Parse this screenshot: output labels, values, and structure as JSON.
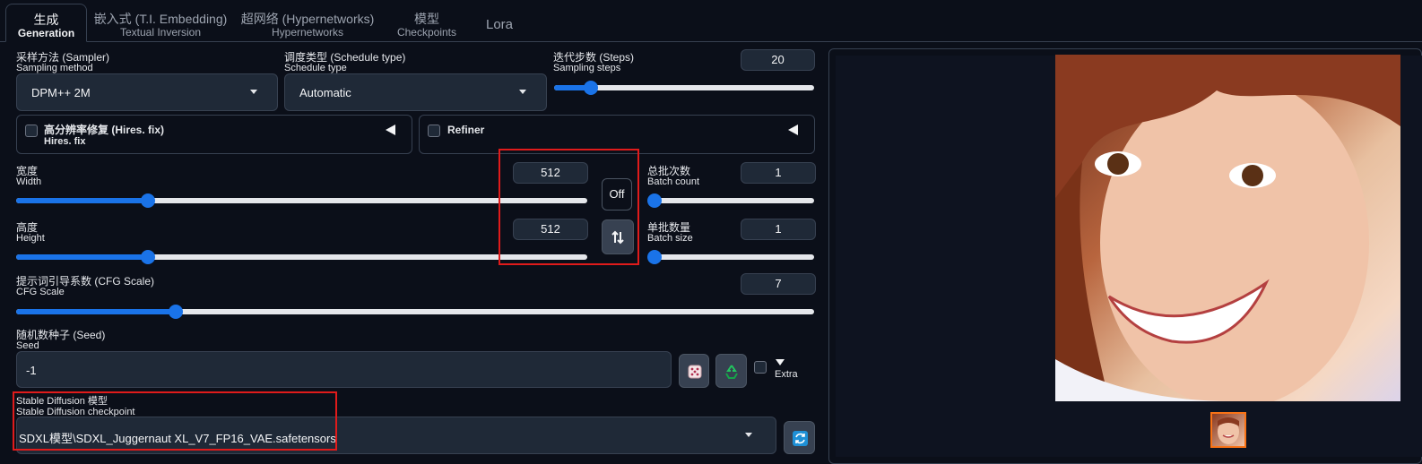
{
  "tabs": [
    {
      "label1": "生成",
      "label2": "Generation"
    },
    {
      "label1": "嵌入式 (T.I. Embedding)",
      "label2": "Textual Inversion"
    },
    {
      "label1": "超网络 (Hypernetworks)",
      "label2": "Hypernetworks"
    },
    {
      "label1": "模型",
      "label2": "Checkpoints"
    },
    {
      "label1": "Lora"
    }
  ],
  "sampler": {
    "label1": "采样方法 (Sampler)",
    "label2": "Sampling method",
    "value": "DPM++ 2M"
  },
  "schedule": {
    "label1": "调度类型 (Schedule type)",
    "label2": "Schedule type",
    "value": "Automatic"
  },
  "steps": {
    "label1": "迭代步数 (Steps)",
    "label2": "Sampling steps",
    "value": "20",
    "fraction": 0.14
  },
  "hires": {
    "label1": "高分辨率修复 (Hires. fix)",
    "label2": "Hires. fix"
  },
  "refiner": {
    "label": "Refiner"
  },
  "width": {
    "label1": "宽度",
    "label2": "Width",
    "value": "512",
    "fraction": 0.23
  },
  "height": {
    "label1": "高度",
    "label2": "Height",
    "value": "512",
    "fraction": 0.23
  },
  "swap": {
    "off_label": "Off",
    "icon": "swap-arrows-icon"
  },
  "batch_count": {
    "label1": "总批次数",
    "label2": "Batch count",
    "value": "1",
    "fraction": 0.0
  },
  "batch_size": {
    "label1": "单批数量",
    "label2": "Batch size",
    "value": "1",
    "fraction": 0.0
  },
  "cfg": {
    "label1": "提示词引导系数 (CFG Scale)",
    "label2": "CFG Scale",
    "value": "7",
    "fraction": 0.2
  },
  "seed": {
    "label1": "随机数种子 (Seed)",
    "label2": "Seed",
    "value": "-1",
    "extra_label": "Extra"
  },
  "checkpoint": {
    "label1": "Stable Diffusion 模型",
    "label2": "Stable Diffusion checkpoint",
    "value": "SDXL模型\\SDXL_Juggernaut XL_V7_FP16_VAE.safetensors"
  },
  "colors": {
    "accent": "#1a73e8",
    "highlight": "#e01b1b",
    "background": "#0b0f19"
  }
}
